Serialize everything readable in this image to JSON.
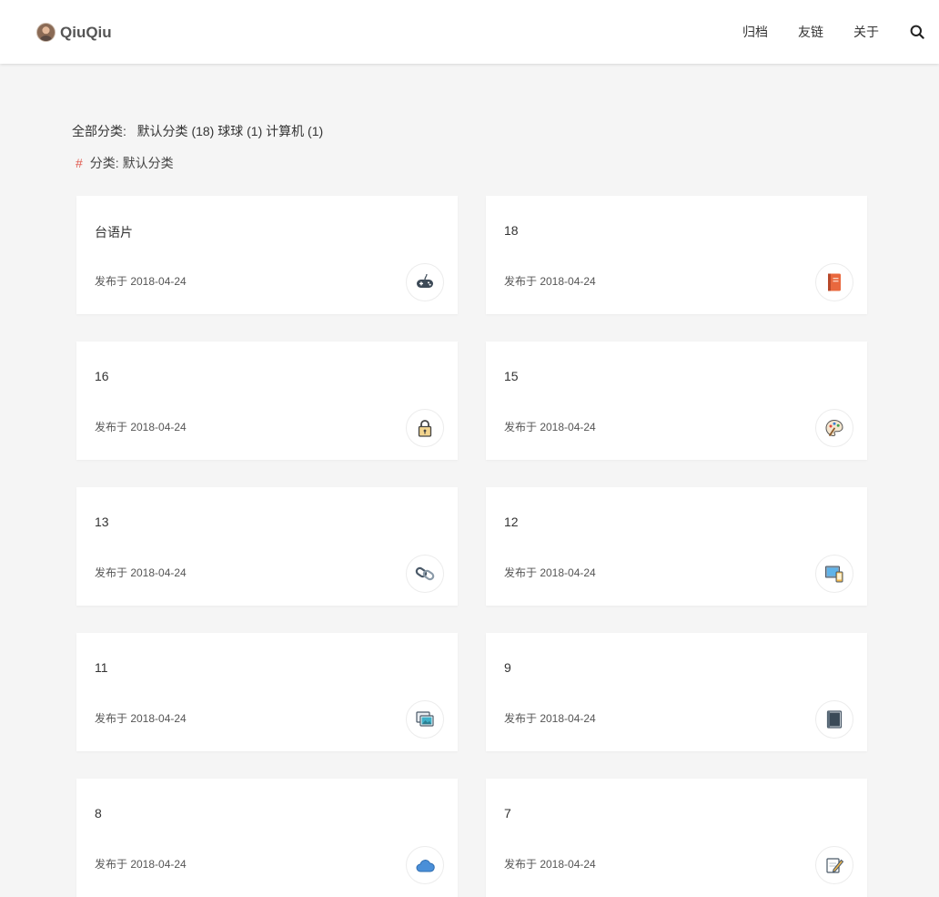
{
  "header": {
    "brand": "QiuQiu",
    "nav": [
      "归档",
      "友链",
      "关于"
    ]
  },
  "categories": {
    "label": "全部分类:",
    "items": [
      "默认分类 (18)",
      "球球 (1)",
      "计算机 (1)"
    ],
    "current_hash": "#",
    "current": "分类: 默认分类"
  },
  "posts": [
    {
      "title": "台语片",
      "date": "发布于 2018-04-24",
      "icon": "gamepad-icon"
    },
    {
      "title": "18",
      "date": "发布于 2018-04-24",
      "icon": "notebook-icon"
    },
    {
      "title": "16",
      "date": "发布于 2018-04-24",
      "icon": "padlock-icon"
    },
    {
      "title": "15",
      "date": "发布于 2018-04-24",
      "icon": "palette-icon"
    },
    {
      "title": "13",
      "date": "发布于 2018-04-24",
      "icon": "chain-link-icon"
    },
    {
      "title": "12",
      "date": "发布于 2018-04-24",
      "icon": "devices-icon"
    },
    {
      "title": "11",
      "date": "发布于 2018-04-24",
      "icon": "gallery-icon"
    },
    {
      "title": "9",
      "date": "发布于 2018-04-24",
      "icon": "book-icon"
    },
    {
      "title": "8",
      "date": "发布于 2018-04-24",
      "icon": "cloud-icon"
    },
    {
      "title": "7",
      "date": "发布于 2018-04-24",
      "icon": "pencil-note-icon"
    }
  ],
  "colors": {
    "background": "#f5f5f5",
    "card": "#ffffff",
    "hash_accent": "#e05a4f",
    "text": "#333333"
  }
}
